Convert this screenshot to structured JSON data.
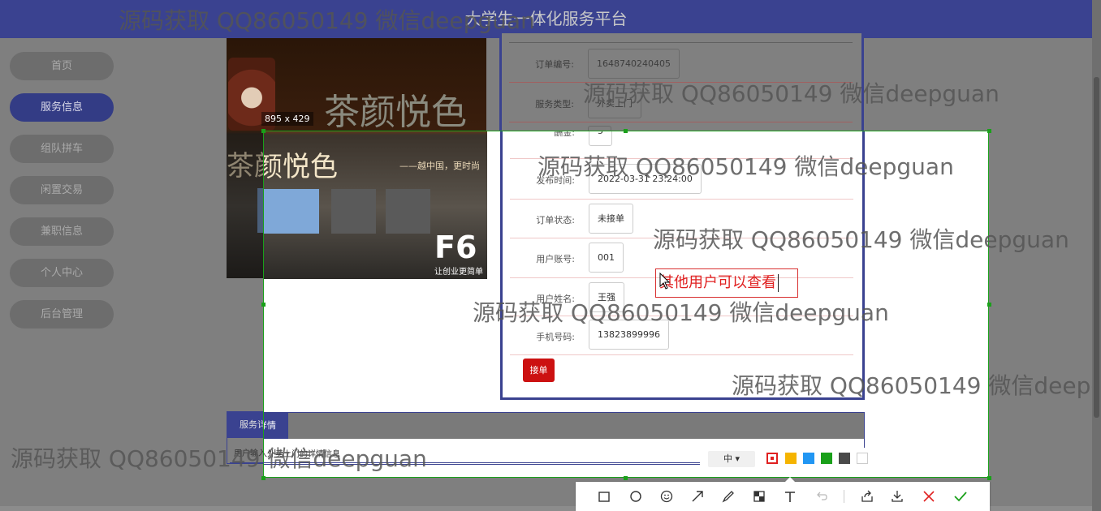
{
  "header": {
    "title": "大学生一体化服务平台"
  },
  "menu": {
    "items": [
      {
        "label": "首页"
      },
      {
        "label": "服务信息"
      },
      {
        "label": "组队拼车"
      },
      {
        "label": "闲置交易"
      },
      {
        "label": "兼职信息"
      },
      {
        "label": "个人中心"
      },
      {
        "label": "后台管理"
      }
    ]
  },
  "photo": {
    "sign_text": "茶颜悦色",
    "slogan": "——越中国，更时尚",
    "logo": "F6",
    "logo_sub": "让创业更简单"
  },
  "order": {
    "fields": [
      {
        "label": "订单编号:",
        "value": "1648740240405"
      },
      {
        "label": "服务类型:",
        "value": "外卖上门"
      },
      {
        "label": "酬金:",
        "value": "5"
      },
      {
        "label": "发布时间:",
        "value": "2022-03-31 23:24:00"
      },
      {
        "label": "订单状态:",
        "value": "未接单"
      },
      {
        "label": "用户账号:",
        "value": "001"
      },
      {
        "label": "用户姓名:",
        "value": "王强"
      },
      {
        "label": "手机号码:",
        "value": "13823899996"
      }
    ],
    "accept_button": "接单"
  },
  "detail": {
    "tab": "服务详情",
    "text": "用户输入外卖上门的详情信息"
  },
  "screenshot_tool": {
    "size_label": "895 x 429",
    "annotation_text": "其他用户可以查看",
    "font_size_option": "中",
    "colors": [
      "#e02020",
      "#f5b400",
      "#2196f3",
      "#1aa01a",
      "#4a4a4a",
      "#ffffff"
    ],
    "tools": [
      "rectangle-icon",
      "ellipse-icon",
      "emoji-icon",
      "arrow-icon",
      "pen-icon",
      "mosaic-icon",
      "text-icon",
      "undo-icon",
      "share-icon",
      "download-icon",
      "cancel-icon",
      "confirm-icon"
    ]
  },
  "watermark": "源码获取 QQ86050149 微信deepguan"
}
